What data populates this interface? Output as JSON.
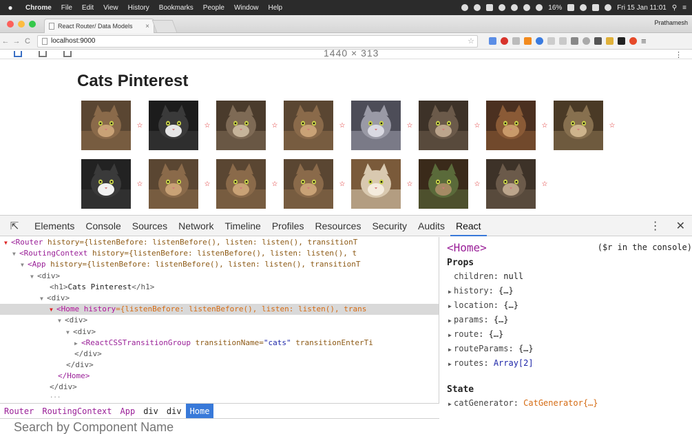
{
  "menubar": {
    "app": "Chrome",
    "items": [
      "File",
      "Edit",
      "View",
      "History",
      "Bookmarks",
      "People",
      "Window",
      "Help"
    ],
    "battery": "16%",
    "datetime": "Fri 15 Jan 11:01"
  },
  "browser": {
    "tab_title": "React Router/ Data Models",
    "tab_close": "×",
    "profile": "Prathamesh",
    "url": "localhost:9000"
  },
  "device_toolbar": {
    "dimensions": "1440 × 313"
  },
  "page": {
    "title": "Cats Pinterest",
    "star": "☆",
    "row1": [
      "cat-1",
      "cat-2",
      "cat-3",
      "cat-4",
      "cat-5",
      "cat-6",
      "cat-7",
      "cat-8"
    ],
    "row2": [
      "cat-9",
      "cat-10",
      "cat-11",
      "cat-12",
      "cat-13",
      "cat-14",
      "cat-15"
    ]
  },
  "devtools": {
    "tabs": [
      "Elements",
      "Console",
      "Sources",
      "Network",
      "Timeline",
      "Profiles",
      "Resources",
      "Security",
      "Audits",
      "React"
    ],
    "active_tab": "React",
    "tree": {
      "router": "<Router",
      "router_attr": "history={listenBefore: listenBefore(), listen: listen(), transitionT",
      "routing_context": "<RoutingContext",
      "routing_context_attr": "history={listenBefore: listenBefore(), listen: listen(), t",
      "app": "<App",
      "app_attr": "history={listenBefore: listenBefore(), listen: listen(), transitionT",
      "div_open": "<div>",
      "h1_open": "<h1>",
      "h1_text": "Cats Pinterest",
      "h1_close": "</h1>",
      "home": "<Home",
      "home_attr_name": "history",
      "home_attr_val": "={listenBefore: listenBefore(), listen: listen(), trans",
      "transition_group": "<ReactCSSTransitionGroup",
      "tg_attr1": "transitionName=",
      "tg_attr1_val": "\"cats\"",
      "tg_attr2": "transitionEnterTi",
      "div_close": "</div>",
      "home_close": "</Home>",
      "ellipsis": "..."
    },
    "breadcrumbs": [
      "Router",
      "RoutingContext",
      "App",
      "div",
      "div",
      "Home"
    ],
    "search_placeholder": "Search by Component Name",
    "side": {
      "component": "<Home>",
      "hint": "($r in the console)",
      "props_label": "Props",
      "props": [
        {
          "key": "children",
          "sep": ": ",
          "val": "null",
          "expandable": false
        },
        {
          "key": "history",
          "sep": ": ",
          "val": "{…}",
          "expandable": true
        },
        {
          "key": "location",
          "sep": ": ",
          "val": "{…}",
          "expandable": true
        },
        {
          "key": "params",
          "sep": ": ",
          "val": "{…}",
          "expandable": true
        },
        {
          "key": "route",
          "sep": ": ",
          "val": "{…}",
          "expandable": true
        },
        {
          "key": "routeParams",
          "sep": ": ",
          "val": "{…}",
          "expandable": true
        },
        {
          "key": "routes",
          "sep": ": ",
          "val": "Array[2]",
          "expandable": true
        }
      ],
      "state_label": "State",
      "state": [
        {
          "key": "catGenerator",
          "sep": ": ",
          "val": "CatGenerator{…}",
          "expandable": true
        }
      ]
    }
  }
}
